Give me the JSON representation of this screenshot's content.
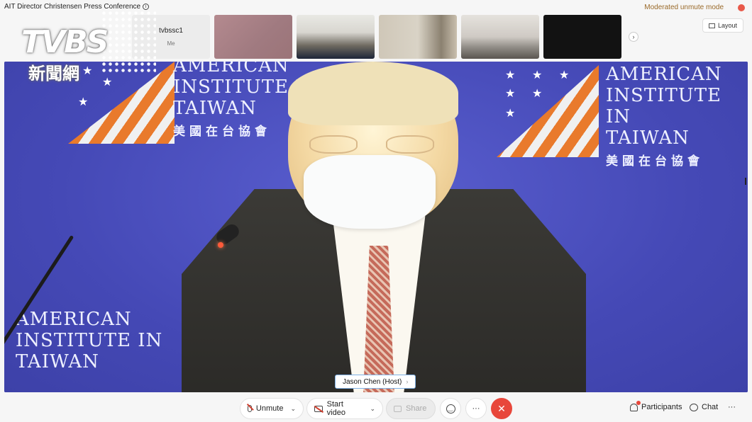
{
  "window": {
    "meeting_title": "AIT Director Christensen Press Conference",
    "info_icon": "info-icon",
    "moderation_label": "Moderated unmute mode",
    "layout_label": "Layout"
  },
  "overlay_logo": {
    "brand": "TVBS",
    "subtitle": "新聞網"
  },
  "participants_strip": {
    "self": {
      "name": "tvbssc1",
      "sub": "Me"
    },
    "next_icon": "chevron-right-icon"
  },
  "main_video": {
    "backdrop_text": {
      "line1": "AMERICAN",
      "line2": "INSTITUTE IN",
      "line3": "TAIWAN",
      "chinese": "美國在台協會"
    },
    "speaker_tag": "Jason Chen (Host)",
    "speaker_tag_chevron": "›"
  },
  "toolbar": {
    "unmute_label": "Unmute",
    "start_video_label": "Start video",
    "share_label": "Share",
    "more_label": "···",
    "end_label": "✕",
    "participants_label": "Participants",
    "chat_label": "Chat",
    "overflow_label": "···"
  },
  "colors": {
    "moderation_text": "#9a6a2a",
    "end_button": "#e8473b",
    "backdrop_blue": "#4549b6",
    "stripe_orange": "#e97a2c"
  }
}
